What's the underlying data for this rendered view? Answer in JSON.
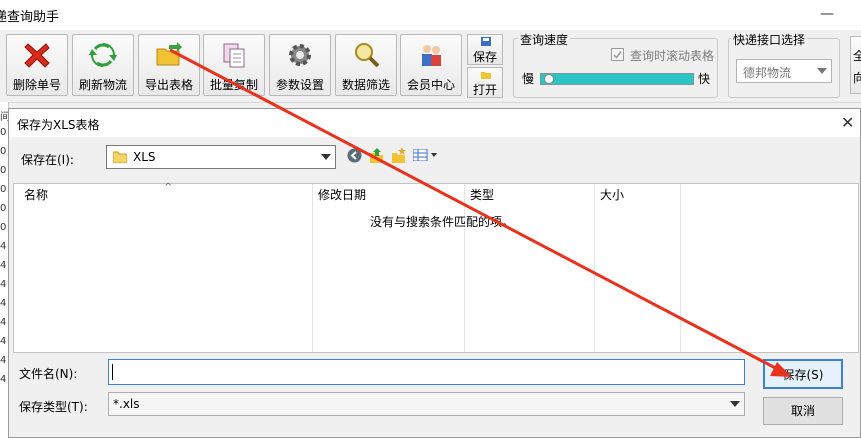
{
  "app": {
    "title": "递查询助手",
    "toolbar": {
      "buttons": [
        {
          "label": "删除单号",
          "icon": "delete-x-icon"
        },
        {
          "label": "刷新物流",
          "icon": "refresh-icon"
        },
        {
          "label": "导出表格",
          "icon": "export-folder-icon"
        },
        {
          "label": "批量复制",
          "icon": "copy-icon"
        },
        {
          "label": "参数设置",
          "icon": "gear-icon"
        },
        {
          "label": "数据筛选",
          "icon": "filter-search-icon"
        },
        {
          "label": "会员中心",
          "icon": "members-icon"
        }
      ],
      "save_label": "保存",
      "open_label": "打开"
    },
    "speed_group": {
      "title": "查询速度",
      "checkbox_label": "查询时滚动表格",
      "slow_label": "慢",
      "fast_label": "快",
      "progress": 0.02
    },
    "courier_group": {
      "title": "快递接口选择",
      "selected": "德邦物流"
    },
    "edge_left_chars": [
      "间",
      "0",
      "0",
      "0",
      "0",
      "0",
      "0",
      "4",
      "4",
      "4",
      "4",
      "4",
      "4",
      "4",
      "4"
    ],
    "edge_right_chars": [
      "全",
      "向"
    ]
  },
  "dialog": {
    "title": "保存为XLS表格",
    "save_in_label": "保存在(I):",
    "save_in_value": "XLS",
    "columns": [
      "名称",
      "修改日期",
      "类型",
      "大小"
    ],
    "empty_message": "没有与搜索条件匹配的项。",
    "filename_label": "文件名(N):",
    "filename_value": "",
    "filetype_label": "保存类型(T):",
    "filetype_value": "*.xls",
    "save_button": "保存(S)",
    "cancel_button": "取消"
  },
  "colors": {
    "arrow": "#e8321e",
    "progress": "#2ec4c4"
  }
}
